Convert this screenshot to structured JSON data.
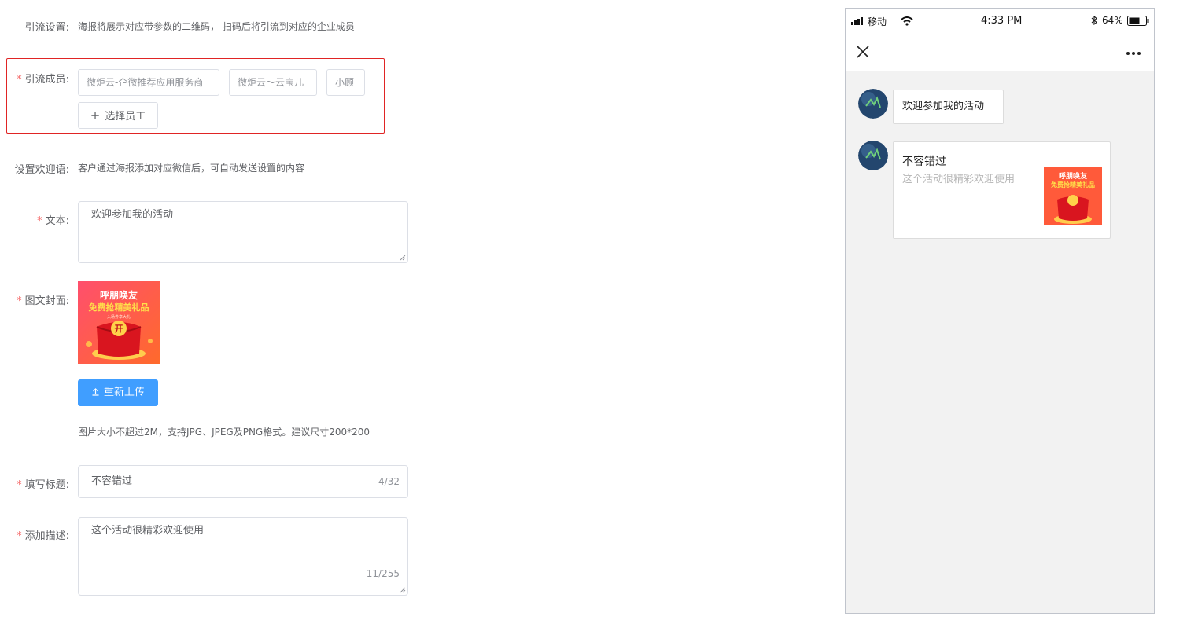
{
  "form": {
    "guide_settings": {
      "label": "引流设置:",
      "hint": "海报将展示对应带参数的二维码， 扫码后将引流到对应的企业成员"
    },
    "guide_members": {
      "label": "引流成员:",
      "required_mark": "*",
      "tags": [
        "微炬云-企微推荐应用服务商",
        "微炬云～云宝儿",
        "小顾"
      ],
      "select_button": "选择员工",
      "plus_symbol": "+"
    },
    "welcome": {
      "label": "设置欢迎语:",
      "hint": "客户通过海报添加对应微信后，可自动发送设置的内容"
    },
    "text": {
      "label": "文本:",
      "required_mark": "*",
      "value": "欢迎参加我的活动"
    },
    "cover": {
      "label": "图文封面:",
      "required_mark": "*",
      "image_line1": "呼朋唤友",
      "image_line2": "免费抢精美礼品",
      "image_small": "入场券享大礼",
      "image_badge": "开",
      "reupload_button": "重新上传",
      "hint": "图片大小不超过2M，支持JPG、JPEG及PNG格式。建议尺寸200*200"
    },
    "title": {
      "label": "填写标题:",
      "required_mark": "*",
      "value": "不容错过",
      "count": "4/32"
    },
    "description": {
      "label": "添加描述:",
      "required_mark": "*",
      "value": "这个活动很精彩欢迎使用",
      "count": "11/255"
    }
  },
  "phone": {
    "status": {
      "carrier": "移动",
      "time": "4:33 PM",
      "battery": "64%"
    },
    "messages": {
      "text_bubble": "欢迎参加我的活动",
      "card_title": "不容错过",
      "card_desc": "这个活动很精彩欢迎使用"
    }
  },
  "colors": {
    "primary": "#409eff",
    "required": "#f56c6c",
    "error_border": "#e02424",
    "poster_red": "#e8322b",
    "poster_gold": "#ffd94a"
  }
}
